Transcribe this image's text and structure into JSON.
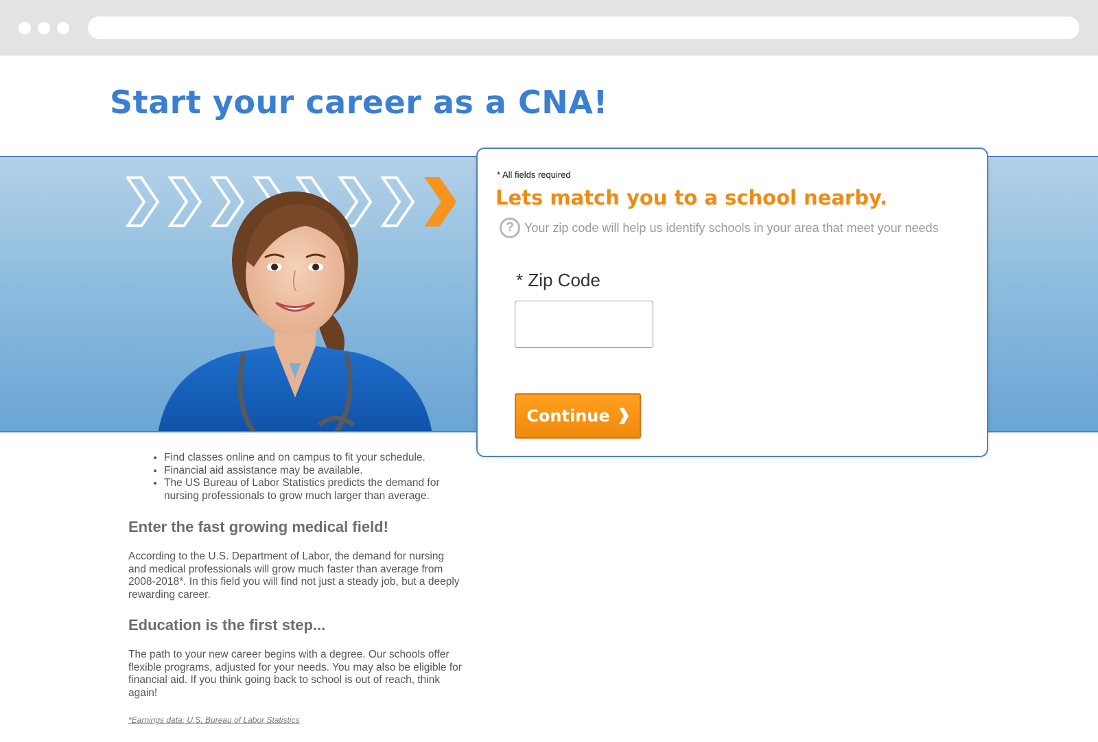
{
  "browser": {
    "url": ""
  },
  "page": {
    "headline": "Start your career as a CNA!"
  },
  "form": {
    "required_note": "* All fields required",
    "title": "Lets match you to a school nearby.",
    "help_text": "Your zip code will help us identify schools in your area that meet your needs",
    "help_icon": "?",
    "zip_label": "* Zip Code",
    "zip_value": "",
    "continue_label": "Continue"
  },
  "content": {
    "bullets": [
      "Find classes online and on campus to fit your schedule.",
      "Financial aid assistance may be available.",
      "The US Bureau of Labor Statistics predicts the demand for nursing professionals to grow much larger than average."
    ],
    "section1_heading": "Enter the fast growing medical field!",
    "section1_text": "According to the U.S. Department of Labor, the demand for nursing and medical professionals will grow much faster than average from 2008-2018*. In this field you will find not just a steady job, but a deeply rewarding career.",
    "section2_heading": "Education is the first step...",
    "section2_text": "The path to your new career begins with a degree. Our schools offer flexible programs, adjusted for your needs. You may also be eligible for financial aid. If you think going back to school is out of reach, think again!",
    "footnote": "*Earnings data: U.S. Bureau of Labor Statistics"
  },
  "colors": {
    "headline_blue": "#3a7fd2",
    "accent_orange": "#f08a12",
    "hero_border": "#4f82bf"
  },
  "icons": {
    "window_controls": [
      "window-dot-icon",
      "window-dot-icon",
      "window-dot-icon"
    ],
    "progress_chevrons": "chevron-right-icon",
    "help": "question-circle-icon",
    "button_arrow": "chevron-right-icon"
  }
}
